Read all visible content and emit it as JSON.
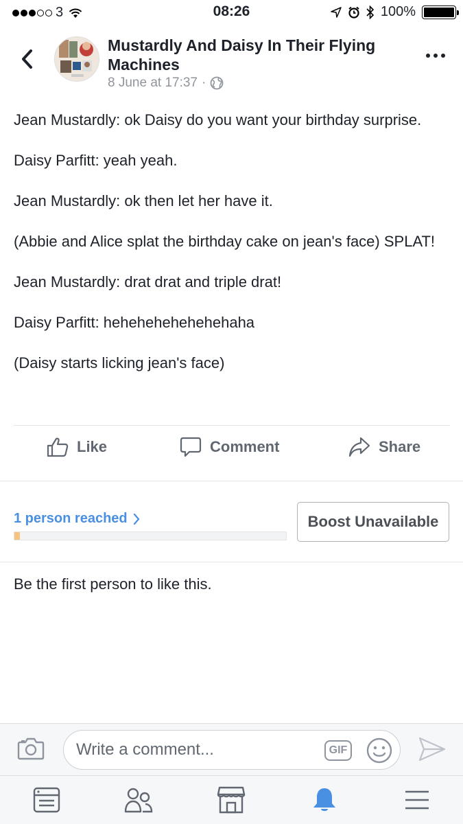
{
  "status_bar": {
    "carrier": "3",
    "time": "08:26",
    "battery": "100%",
    "signal_strength": 3,
    "battery_level": 1.0
  },
  "header": {
    "page_name": "Mustardly And Daisy In Their Flying Machines",
    "post_date": "8 June at 17:37",
    "separator": "·",
    "icons": [
      "back-chevron-icon",
      "globe-icon",
      "more-dots-icon"
    ]
  },
  "post": {
    "paragraphs": [
      "Jean Mustardly: ok Daisy do you want your birthday surprise.",
      "Daisy Parfitt: yeah yeah.",
      "Jean Mustardly: ok then let her have it.",
      "(Abbie and Alice splat the birthday cake on jean's face) SPLAT!",
      "Jean Mustardly: drat drat and triple drat!",
      "Daisy Parfitt: hehehehehehehehaha",
      "(Daisy starts licking jean's face)"
    ]
  },
  "actions": {
    "like": "Like",
    "comment": "Comment",
    "share": "Share"
  },
  "insights": {
    "reach_label": "1 person reached",
    "reach_progress": 0.02,
    "boost_label": "Boost Unavailable"
  },
  "likes_text": "Be the first person to like this.",
  "composer": {
    "placeholder": "Write a comment...",
    "gif_label": "GIF"
  },
  "tabs": [
    {
      "name": "news-feed",
      "icon": "newsfeed-icon",
      "active": false
    },
    {
      "name": "friends",
      "icon": "friends-icon",
      "active": false
    },
    {
      "name": "marketplace",
      "icon": "marketplace-icon",
      "active": false
    },
    {
      "name": "notifications",
      "icon": "bell-icon",
      "active": true
    },
    {
      "name": "menu",
      "icon": "hamburger-icon",
      "active": false
    }
  ],
  "colors": {
    "link_blue": "#4a90e2",
    "active_tab": "#4a90e2",
    "icon_gray": "#8d949e",
    "text": "#1d2129",
    "secondary_text": "#90949c",
    "reach_fill": "#f7c380"
  }
}
